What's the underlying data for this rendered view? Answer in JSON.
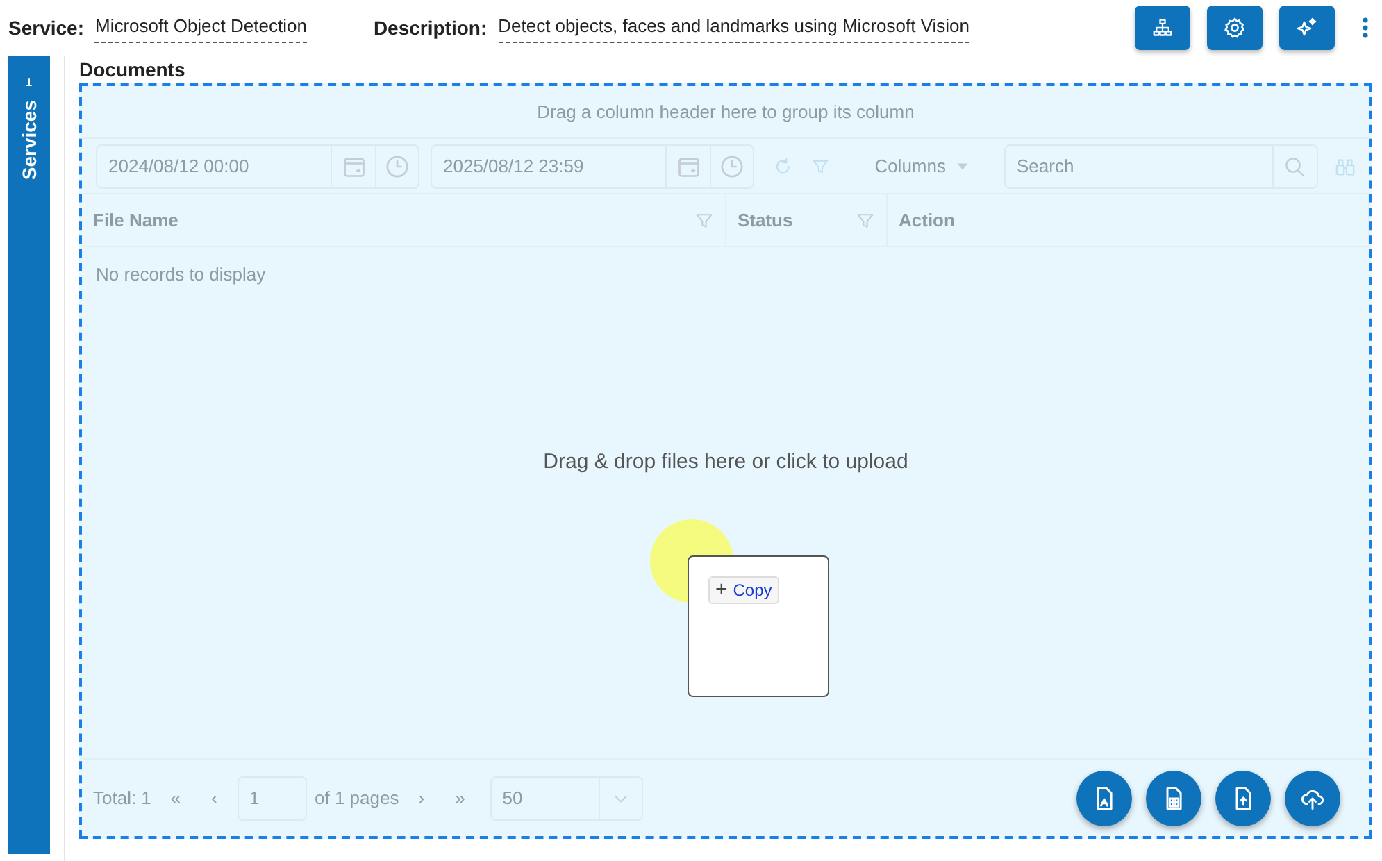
{
  "header": {
    "fields": [
      {
        "label": "Service:",
        "value": "Microsoft Object Detection"
      },
      {
        "label": "Description:",
        "value": "Detect objects, faces and landmarks using Microsoft Vision"
      }
    ]
  },
  "sidebar": {
    "tab": "Services"
  },
  "section_title": "Documents",
  "grid": {
    "group_hint": "Drag a column header here to group its column",
    "date_from": "2024/08/12 00:00",
    "date_to": "2025/08/12 23:59",
    "columns_button": "Columns",
    "search_placeholder": "Search",
    "columns": [
      {
        "label": "File Name",
        "filterable": true
      },
      {
        "label": "Status",
        "filterable": true
      },
      {
        "label": "Action",
        "filterable": false
      }
    ],
    "empty_text": "No records to display",
    "pager": {
      "total": "Total: 1",
      "first": "«",
      "prev": "‹",
      "page": "1",
      "of_pages": "of 1 pages",
      "next": "›",
      "last": "»",
      "page_size": "50"
    }
  },
  "dropzone": {
    "text": "Drag & drop files here or click to upload"
  },
  "drag_preview": {
    "symbol": "+",
    "action": "Copy"
  }
}
